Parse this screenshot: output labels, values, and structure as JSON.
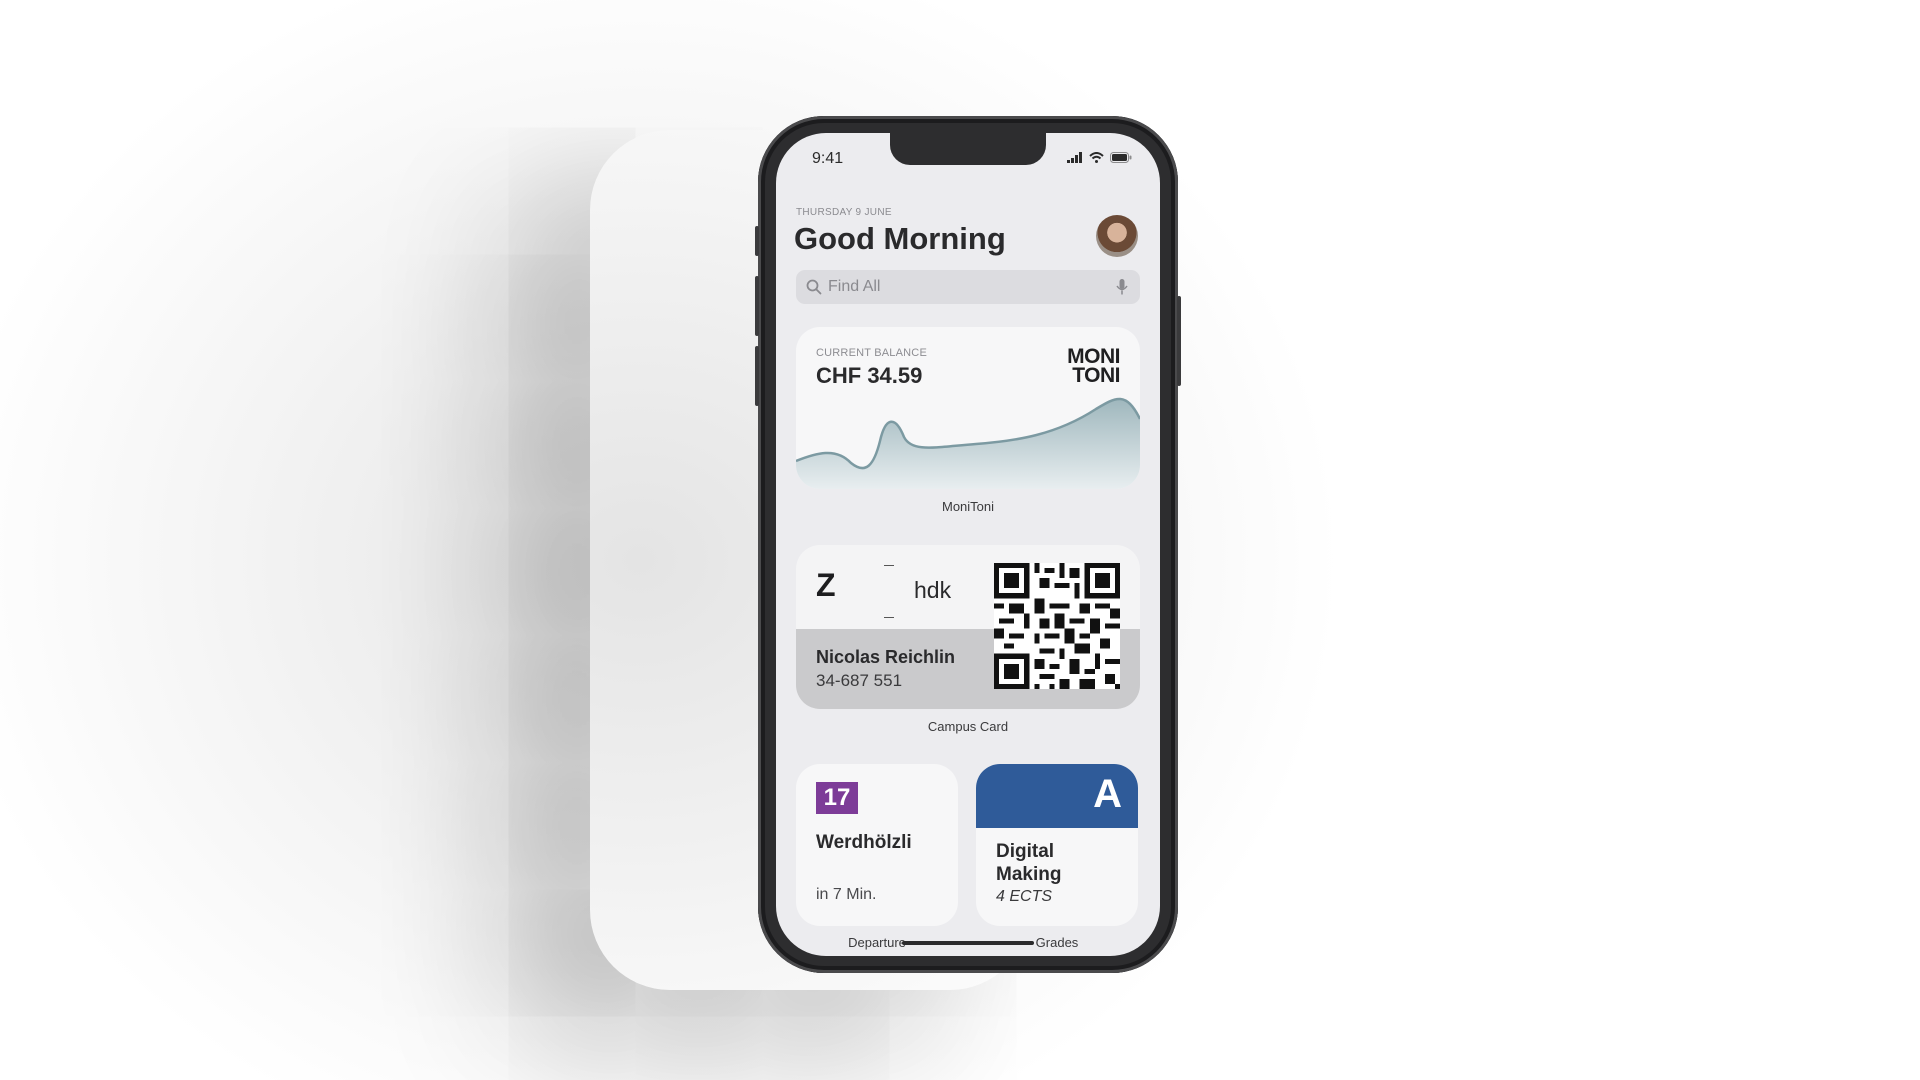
{
  "status_bar": {
    "time": "9:41"
  },
  "header": {
    "date": "THURSDAY 9 JUNE",
    "greeting": "Good Morning"
  },
  "search": {
    "placeholder": "Find All"
  },
  "balance_widget": {
    "label": "CURRENT BALANCE",
    "value": "CHF 34.59",
    "brand_line1": "MONI",
    "brand_line2": "TONI",
    "caption": "MoniToni"
  },
  "campus_widget": {
    "logo_left": "Z",
    "logo_right": "hdk",
    "holder_name": "Nicolas Reichlin",
    "holder_id": "34-687 551",
    "caption": "Campus Card"
  },
  "departure_widget": {
    "line": "17",
    "stop": "Werdhölzli",
    "time": "in 7 Min.",
    "caption": "Departure",
    "line_color": "#7d3c98"
  },
  "grades_widget": {
    "grade": "A",
    "course_line1": "Digital",
    "course_line2": "Making",
    "ects": "4 ECTS",
    "caption": "Grades",
    "accent_color": "#2f5b99"
  },
  "icons": [
    "signal-icon",
    "wifi-icon",
    "battery-icon",
    "search-icon",
    "microphone-icon",
    "qr-code-icon"
  ]
}
